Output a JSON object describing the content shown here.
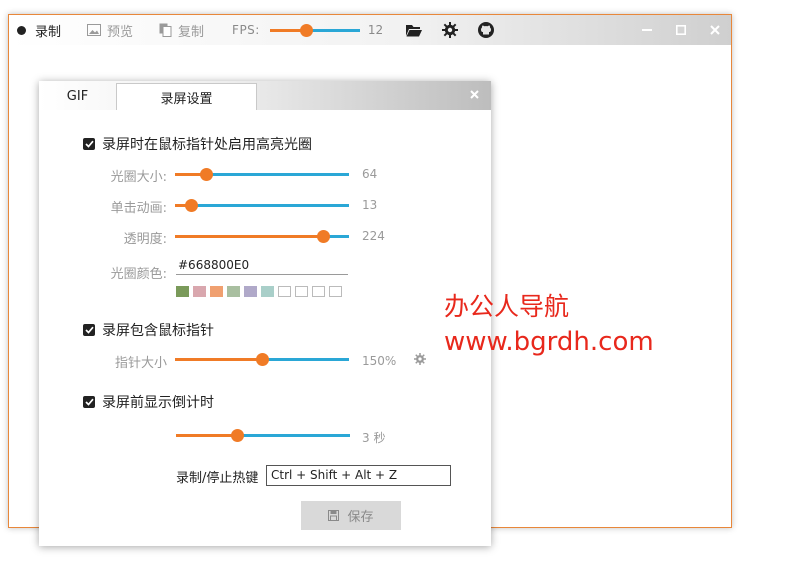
{
  "toolbar": {
    "record_label": "录制",
    "preview_label": "预览",
    "copy_label": "复制",
    "fps_label": "FPS:",
    "fps_value": "12",
    "fps_level": 0.4
  },
  "dialog": {
    "tabs": [
      {
        "label": "GIF"
      },
      {
        "label": "录屏设置"
      }
    ],
    "highlight": {
      "checkbox_label": "录屏时在鼠标指针处启用高亮光圈",
      "size_label": "光圈大小:",
      "size_value": "64",
      "size_level": 0.18,
      "click_anim_label": "单击动画:",
      "click_anim_value": "13",
      "click_anim_level": 0.09,
      "opacity_label": "透明度:",
      "opacity_value": "224",
      "opacity_level": 0.85,
      "color_label": "光圈颜色:",
      "color_value": "#668800E0",
      "swatches": [
        "#7a9a5a",
        "#d9a7ae",
        "#f0a070",
        "#a9bfa0",
        "#b0a9c9",
        "#a9cfc9",
        "#ffffff",
        "#ffffff",
        "#ffffff",
        "#ffffff"
      ]
    },
    "cursor": {
      "checkbox_label": "录屏包含鼠标指针",
      "size_label": "指针大小",
      "size_value": "150%",
      "size_level": 0.5
    },
    "countdown": {
      "checkbox_label": "录屏前显示倒计时",
      "value": "3 秒",
      "level": 0.35
    },
    "hotkey": {
      "label": "录制/停止热键",
      "value": "Ctrl + Shift + Alt + Z"
    },
    "save_label": "保存"
  },
  "watermark": {
    "line1": "办公人导航",
    "line2": "www.bgrdh.com"
  },
  "colors": {
    "accent": "#f07b26",
    "track": "#2aa7d6",
    "watermark": "#e8281c"
  }
}
